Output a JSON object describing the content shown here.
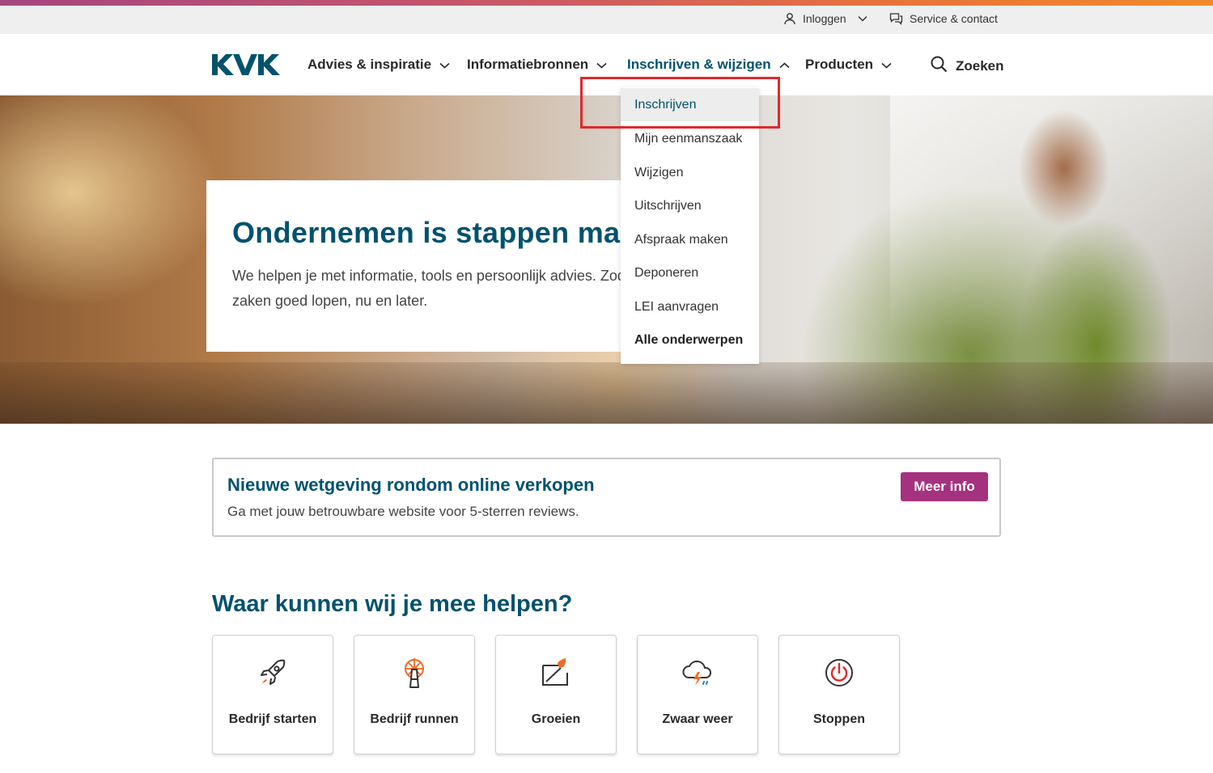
{
  "colors": {
    "brand": "#00526e",
    "accent_button": "#a4327f",
    "highlight_box": "#e3262b"
  },
  "utility": {
    "login_label": "Inloggen",
    "service_label": "Service & contact"
  },
  "brand": {
    "logo_text": "KVK"
  },
  "nav": {
    "items": [
      {
        "label": "Advies & inspiratie",
        "expanded": false
      },
      {
        "label": "Informatiebronnen",
        "expanded": false
      },
      {
        "label": "Inschrijven & wijzigen",
        "expanded": true
      },
      {
        "label": "Producten",
        "expanded": false
      }
    ],
    "search_label": "Zoeken"
  },
  "dropdown": {
    "items": [
      {
        "label": "Inschrijven",
        "selected": true
      },
      {
        "label": "Mijn eenmanszaak"
      },
      {
        "label": "Wijzigen"
      },
      {
        "label": "Uitschrijven"
      },
      {
        "label": "Afspraak maken"
      },
      {
        "label": "Deponeren"
      },
      {
        "label": "LEI aanvragen"
      },
      {
        "label": "Alle onderwerpen"
      }
    ]
  },
  "hero": {
    "title": "Ondernemen is stappen maken",
    "text": "We helpen je met informatie, tools en persoonlijk advies. Zodat je zaken goed lopen, nu en later."
  },
  "notice": {
    "title": "Nieuwe wetgeving rondom online verkopen",
    "text": "Ga met jouw betrouwbare website voor 5-sterren reviews.",
    "button_label": "Meer info"
  },
  "help": {
    "title": "Waar kunnen wij je mee helpen?",
    "tiles": [
      {
        "label": "Bedrijf starten",
        "icon": "rocket-icon"
      },
      {
        "label": "Bedrijf runnen",
        "icon": "lighthouse-icon"
      },
      {
        "label": "Groeien",
        "icon": "growth-chart-icon"
      },
      {
        "label": "Zwaar weer",
        "icon": "storm-cloud-icon"
      },
      {
        "label": "Stoppen",
        "icon": "power-icon"
      }
    ]
  }
}
